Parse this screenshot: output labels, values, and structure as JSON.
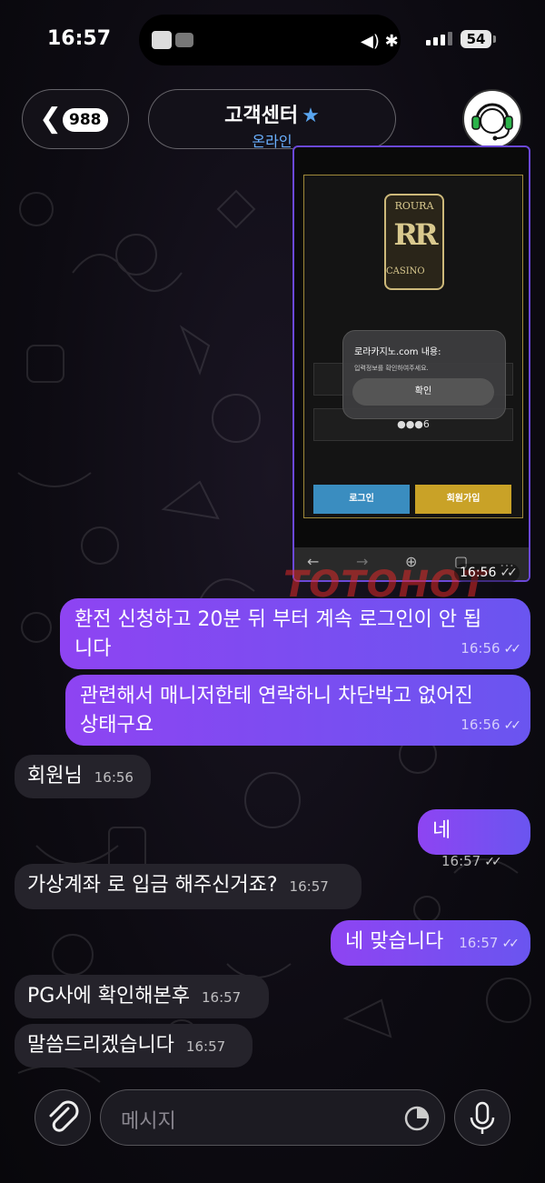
{
  "status_bar": {
    "time": "16:57",
    "battery": "54"
  },
  "header": {
    "back_count": "988",
    "title": "고객센터",
    "subtitle": "온라인"
  },
  "image_message": {
    "logo_top": "ROURA",
    "logo_mark": "RR",
    "logo_bottom": "CASINO",
    "alert_title": "로라카지노.com 내용:",
    "alert_text": "입력정보를 확인하여주세요.",
    "alert_button": "확인",
    "password_mask": "●●●6",
    "login_button": "로그인",
    "signup_button": "회원가입",
    "time": "16:56"
  },
  "watermark": "TOTOHOT",
  "messages": [
    {
      "side": "out",
      "text_line1": "환전 신청하고 20분 뒤 부터 계속 로그인이 안 됩",
      "text_line2": "니다",
      "time": "16:56"
    },
    {
      "side": "out",
      "text_line1": "관련해서 매니저한테 연락하니 차단박고 없어진",
      "text_line2": "상태구요",
      "time": "16:56"
    },
    {
      "side": "in",
      "text": "회원님",
      "time": "16:56"
    },
    {
      "side": "out",
      "text": "네",
      "time": "16:57"
    },
    {
      "side": "in",
      "text": "가상계좌 로 입금 해주신거죠?",
      "time": "16:57"
    },
    {
      "side": "out",
      "text": "네 맞습니다",
      "time": "16:57"
    },
    {
      "side": "in",
      "text": "PG사에 확인해본후",
      "time": "16:57"
    },
    {
      "side": "in",
      "text": "말씀드리겠습니다",
      "time": "16:57"
    }
  ],
  "input": {
    "placeholder": "메시지"
  },
  "icons": [
    "back-chevron-icon",
    "star-icon",
    "headset-icon",
    "paperclip-icon",
    "sticker-icon",
    "microphone-icon"
  ]
}
